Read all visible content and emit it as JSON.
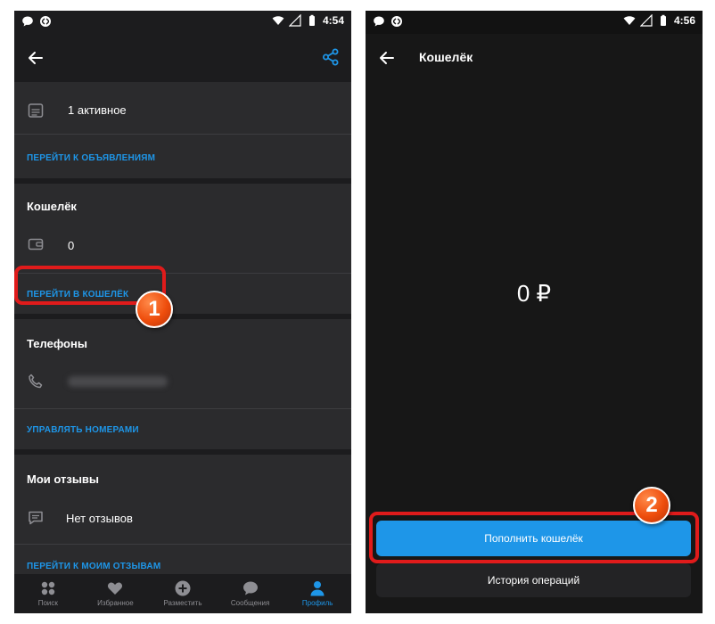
{
  "left_screen": {
    "status_bar": {
      "time": "4:54",
      "left_icons": [
        "chat-bubble-icon",
        "shazam-icon"
      ],
      "right_icons": [
        "wifi-icon",
        "signal-icon",
        "battery-icon"
      ]
    },
    "app_bar": {
      "back_icon": "arrow-left-icon",
      "share_icon": "share-icon"
    },
    "ads": {
      "count_text": "1 активное",
      "link": "ПЕРЕЙТИ К ОБЪЯВЛЕНИЯМ"
    },
    "wallet": {
      "title": "Кошелёк",
      "value": "0",
      "link": "ПЕРЕЙТИ В КОШЕЛЁК"
    },
    "phones": {
      "title": "Телефоны",
      "link": "УПРАВЛЯТЬ НОМЕРАМИ"
    },
    "reviews": {
      "title": "Мои отзывы",
      "value": "Нет отзывов",
      "link": "ПЕРЕЙТИ К МОИМ ОТЗЫВАМ"
    },
    "bottom_nav": [
      {
        "label": "Поиск",
        "icon": "search-icon"
      },
      {
        "label": "Избранное",
        "icon": "heart-icon"
      },
      {
        "label": "Разместить",
        "icon": "plus-icon"
      },
      {
        "label": "Сообщения",
        "icon": "message-icon"
      },
      {
        "label": "Профиль",
        "icon": "person-icon",
        "active": true
      }
    ]
  },
  "right_screen": {
    "status_bar": {
      "time": "4:56",
      "left_icons": [
        "chat-bubble-icon",
        "shazam-icon"
      ],
      "right_icons": [
        "wifi-icon",
        "signal-icon",
        "battery-icon"
      ]
    },
    "app_bar": {
      "title": "Кошелёк",
      "back_icon": "arrow-left-icon"
    },
    "balance": "0 ₽",
    "topup_button": "Пополнить кошелёк",
    "history_button": "История операций"
  },
  "callouts": [
    "1",
    "2"
  ],
  "colors": {
    "accent": "#1e96e8",
    "highlight": "#e01b1b",
    "callout": "#ee4d0c",
    "background": "#2b2b2d"
  }
}
